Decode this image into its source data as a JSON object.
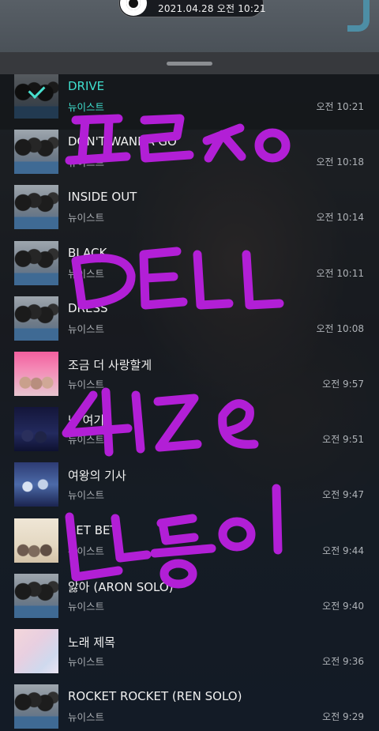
{
  "status": {
    "datetime": "2021.04.28 오전 10:21"
  },
  "colors": {
    "accent": "#3fe0cf",
    "scribble": "#b21fd6"
  },
  "tracks": [
    {
      "title": "DRIVE",
      "artist": "뉴이스트",
      "time": "오전 10:21",
      "art": "nuest",
      "current": true
    },
    {
      "title": "DON'T WANNA GO",
      "artist": "뉴이스트",
      "time": "오전 10:18",
      "art": "nuest"
    },
    {
      "title": "INSIDE OUT",
      "artist": "뉴이스트",
      "time": "오전 10:14",
      "art": "nuest"
    },
    {
      "title": "BLACK",
      "artist": "뉴이스트",
      "time": "오전 10:11",
      "art": "nuest"
    },
    {
      "title": "DRESS",
      "artist": "뉴이스트",
      "time": "오전 10:08",
      "art": "nuest"
    },
    {
      "title": "조금 더 사랑할게",
      "artist": "뉴이스트",
      "time": "오전 9:57",
      "art": "pink"
    },
    {
      "title": "난 여기",
      "artist": "뉴이스트",
      "time": "오전 9:51",
      "art": "night"
    },
    {
      "title": "여왕의 기사",
      "artist": "뉴이스트",
      "time": "오전 9:47",
      "art": "knight"
    },
    {
      "title": "BET BET",
      "artist": "뉴이스트",
      "time": "오전 9:44",
      "art": "betbet"
    },
    {
      "title": "앓아 (ARON SOLO)",
      "artist": "뉴이스트",
      "time": "오전 9:40",
      "art": "nuest"
    },
    {
      "title": "노래 제목",
      "artist": "뉴이스트",
      "time": "오전 9:36",
      "art": "pastel"
    },
    {
      "title": "ROCKET ROCKET (REN SOLO)",
      "artist": "뉴이스트",
      "time": "오전 9:29",
      "art": "nuest"
    }
  ]
}
